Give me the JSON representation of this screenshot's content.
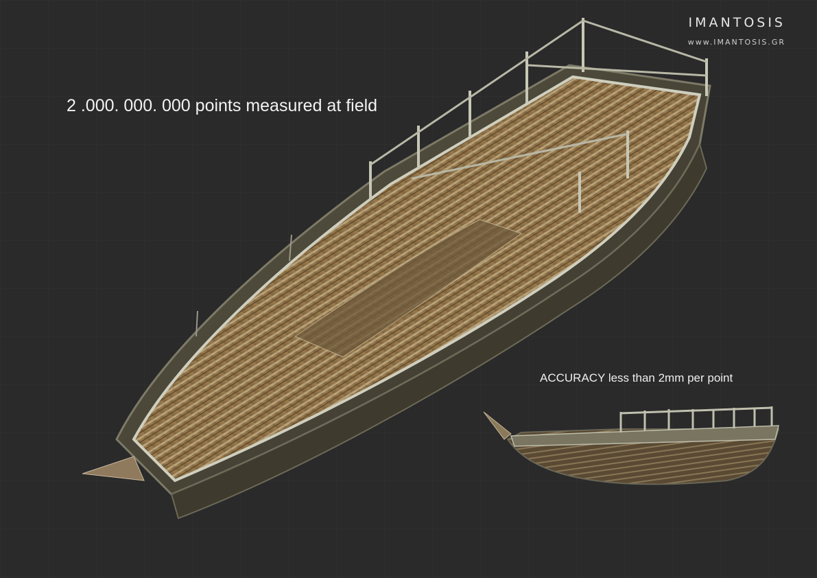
{
  "brand": {
    "name": "IMANTOSIS",
    "url": "www.IMANTOSIS.GR"
  },
  "headline": "2 .000. 000. 000  points measured at field",
  "accuracy_note": "ACCURACY less than 2mm per point",
  "colors": {
    "background": "#2a2a2b",
    "hull_dark": "#4a4433",
    "deck_plank": "#8a6a3e",
    "frame_light": "#c9c9b8"
  }
}
